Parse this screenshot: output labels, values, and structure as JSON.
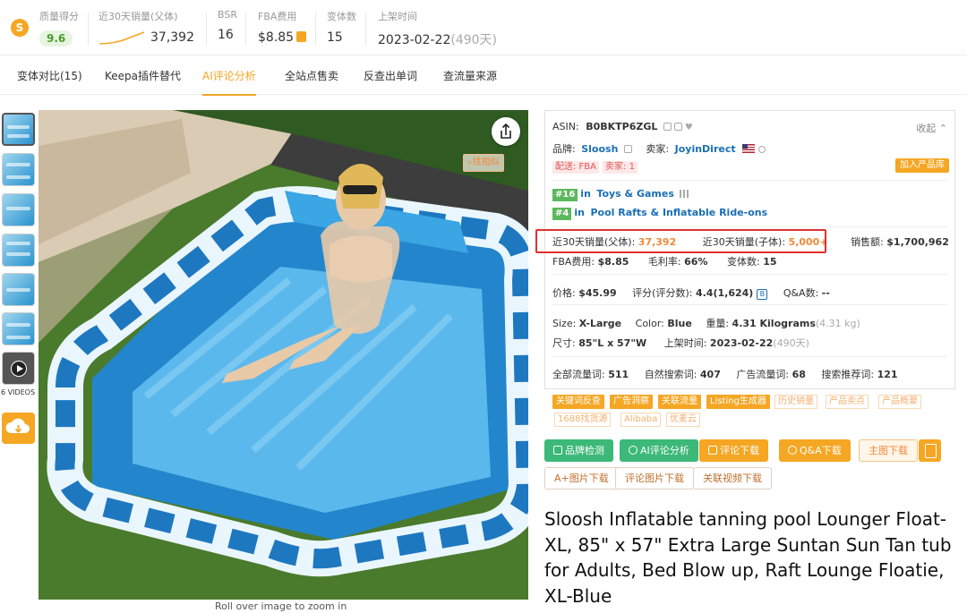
{
  "metrics": {
    "logo": "S",
    "quality_label": "质量得分",
    "quality_value": "9.6",
    "sales_label": "近30天销量(父体)",
    "sales_value": "37,392",
    "bsr_label": "BSR",
    "bsr_value": "16",
    "fba_label": "FBA费用",
    "fba_value": "$8.85",
    "variants_label": "变体数",
    "variants_value": "15",
    "listed_label": "上架时间",
    "listed_value": "2023-02-22",
    "listed_days": "(490天)"
  },
  "tabs": [
    {
      "label": "变体对比(15)"
    },
    {
      "label": "Keepa插件替代"
    },
    {
      "label": "AI评论分析"
    },
    {
      "label": "全站点售卖"
    },
    {
      "label": "反查出单词"
    },
    {
      "label": "查流量来源"
    }
  ],
  "gallery": {
    "videos_label": "6 VIDEOS",
    "zoom_hint": "Roll over image to zoom in",
    "find_similar": "找相似"
  },
  "info": {
    "asin_label": "ASIN:",
    "asin_value": "B0BKTP6ZGL",
    "collapse": "收起",
    "brand_label": "品牌:",
    "brand_value": "Sloosh",
    "seller_label": "卖家:",
    "seller_value": "JoyinDirect",
    "tag_fba": "配送: FBA",
    "tag_sellers": "卖家: 1",
    "add_library": "加入产品库",
    "rank1_num": "#16",
    "rank1_in": "in",
    "rank1_cat": "Toys & Games",
    "rank2_num": "#4",
    "rank2_in": "in",
    "rank2_cat": "Pool Rafts & Inflatable Ride-ons",
    "parent_sales_label": "近30天销量(父体):",
    "parent_sales_value": "37,392",
    "child_sales_label": "近30天销量(子体):",
    "child_sales_value": "5,000+",
    "revenue_label": "销售额:",
    "revenue_value": "$1,700,962",
    "fba_label": "FBA费用:",
    "fba_value": "$8.85",
    "margin_label": "毛利率:",
    "margin_value": "66%",
    "variants_label": "变体数:",
    "variants_value": "15",
    "price_label": "价格:",
    "price_value": "$45.99",
    "rating_label": "评分(评分数):",
    "rating_value": "4.4(1,624)",
    "rating_badge": "B",
    "qa_label": "Q&A数:",
    "qa_value": "--",
    "size_label": "Size:",
    "size_value": "X-Large",
    "color_label": "Color:",
    "color_value": "Blue",
    "weight_label": "重量:",
    "weight_value": "4.31 Kilograms",
    "weight_alt": "(4.31 kg)",
    "dims_label": "尺寸:",
    "dims_value": "85\"L x 57\"W",
    "listed_label": "上架时间:",
    "listed_value": "2023-02-22",
    "listed_days": "(490天)",
    "traffic_all_label": "全部流量词:",
    "traffic_all_value": "511",
    "traffic_natural_label": "自然搜索词:",
    "traffic_natural_value": "407",
    "traffic_ads_label": "广告流量词:",
    "traffic_ads_value": "68",
    "traffic_rec_label": "搜索推荐词:",
    "traffic_rec_value": "121"
  },
  "tool_tags": [
    {
      "label": "关键词反查"
    },
    {
      "label": "广告洞察"
    },
    {
      "label": "关联流量"
    },
    {
      "label": "Listing生成器"
    },
    {
      "label": "历史销量"
    },
    {
      "label": "产品卖点"
    },
    {
      "label": "产品概要"
    },
    {
      "label": "1688找货源"
    },
    {
      "label": "Alibaba"
    },
    {
      "label": "优麦云"
    }
  ],
  "actions": {
    "brand_check": "品牌检测",
    "ai_review": "AI评论分析",
    "review_download": "评论下载",
    "qa_download": "Q&A下载",
    "main_image_download": "主图下载",
    "aplus_download": "A+图片下载",
    "review_image_download": "评论图片下载",
    "related_video_download": "关联视频下载"
  },
  "product_title": "Sloosh Inflatable tanning pool Lounger Float-XL, 85\" x 57\" Extra Large Suntan Sun Tan tub for Adults, Bed Blow up, Raft Lounge Floatie, XL-Blue",
  "colors": {
    "accent": "#f5a623",
    "link_blue": "#1a6fb5",
    "green": "#3cb878",
    "highlight_red": "#e03030"
  }
}
